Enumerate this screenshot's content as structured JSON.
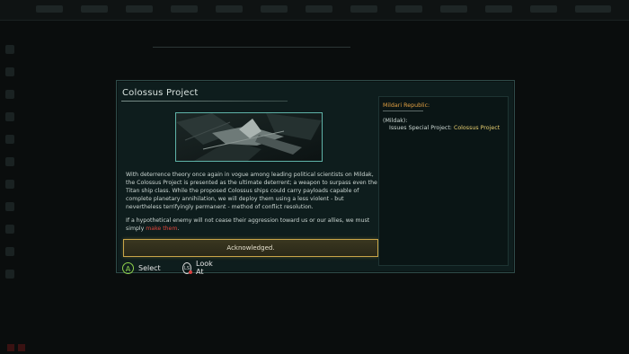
{
  "modal": {
    "title": "Colossus Project",
    "image_alt": "colossus-ship-icon",
    "description": "With deterrence theory once again in vogue among leading political scientists on Mildak, the Colossus Project is presented as the ultimate deterrent; a weapon to surpass even the Titan ship class. While the proposed Colossus ships could carry payloads capable of complete planetary annihilation, we will deploy them using a less violent - but nevertheless terrifyingly permanent - method of conflict resolution.",
    "closing_text": "If a hypothetical enemy will not cease their aggression toward us or our allies, we must simply ",
    "closing_highlight": "make them",
    "closing_end": ".",
    "acknowledge_label": "Acknowledged."
  },
  "effects": {
    "heading": "Mildari Republic:",
    "entity": "(Mildak):",
    "effect_prefix": "Issues Special Project: ",
    "effect_project": "Colossus Project"
  },
  "hints": {
    "select_key": "A",
    "select_label": "Select",
    "look_key": "LS",
    "look_label": "Look At"
  },
  "colors": {
    "accent_gold": "#c9a648",
    "heading_orange": "#e2a042",
    "highlight_red": "#e0463c",
    "project_yellow": "#e8cf70"
  }
}
